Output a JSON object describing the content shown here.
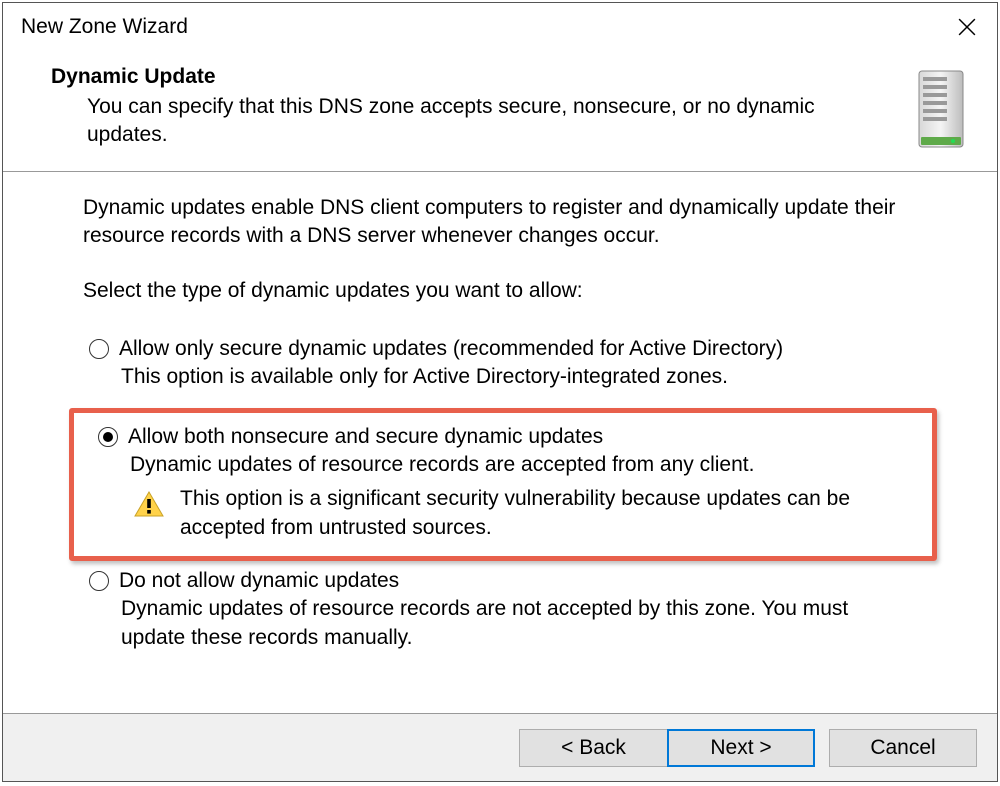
{
  "window": {
    "title": "New Zone Wizard"
  },
  "header": {
    "title": "Dynamic Update",
    "description": "You can specify that this DNS zone accepts secure, nonsecure, or no dynamic updates."
  },
  "content": {
    "intro": "Dynamic updates enable DNS client computers to register and dynamically update their resource records with a DNS server whenever changes occur.",
    "select_prompt": "Select the type of dynamic updates you want to allow:",
    "options": [
      {
        "label": "Allow only secure dynamic updates (recommended for Active Directory)",
        "description": "This option is available only for Active Directory-integrated zones.",
        "selected": false,
        "warning": null,
        "highlighted": false
      },
      {
        "label": "Allow both nonsecure and secure dynamic updates",
        "description": "Dynamic updates of resource records are accepted from any client.",
        "selected": true,
        "warning": "This option is a significant security vulnerability because updates can be accepted from untrusted sources.",
        "highlighted": true
      },
      {
        "label": "Do not allow dynamic updates",
        "description": "Dynamic updates of resource records are not accepted by this zone. You must update these records manually.",
        "selected": false,
        "warning": null,
        "highlighted": false
      }
    ]
  },
  "footer": {
    "back": "< Back",
    "next": "Next >",
    "cancel": "Cancel"
  }
}
